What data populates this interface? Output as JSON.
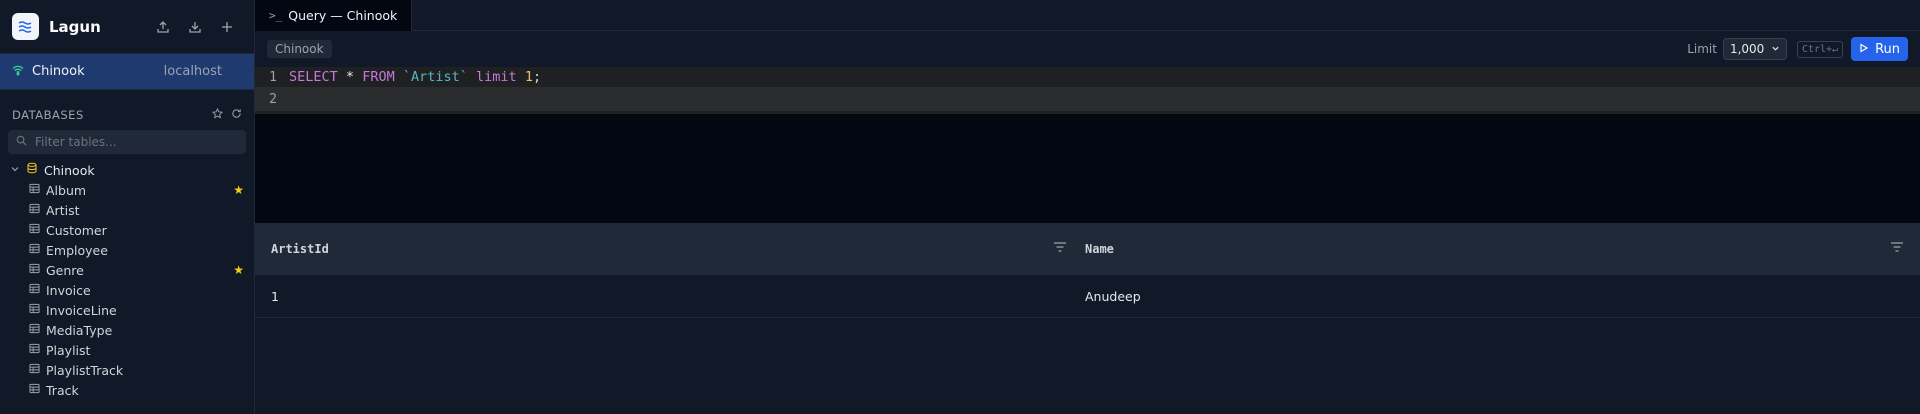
{
  "app": {
    "name": "Lagun"
  },
  "connection": {
    "name": "Chinook",
    "host": "localhost"
  },
  "sidebar": {
    "databases_title": "DATABASES",
    "filter_placeholder": "Filter tables...",
    "database": "Chinook",
    "tables": [
      {
        "label": "Album",
        "starred": true
      },
      {
        "label": "Artist",
        "starred": false
      },
      {
        "label": "Customer",
        "starred": false
      },
      {
        "label": "Employee",
        "starred": false
      },
      {
        "label": "Genre",
        "starred": true
      },
      {
        "label": "Invoice",
        "starred": false
      },
      {
        "label": "InvoiceLine",
        "starred": false
      },
      {
        "label": "MediaType",
        "starred": false
      },
      {
        "label": "Playlist",
        "starred": false
      },
      {
        "label": "PlaylistTrack",
        "starred": false
      },
      {
        "label": "Track",
        "starred": false
      }
    ]
  },
  "tab": {
    "icon": ">_",
    "label": "Query — Chinook"
  },
  "toolbar": {
    "db_chip": "Chinook",
    "limit_label": "Limit",
    "limit_value": "1,000",
    "shortcut": "Ctrl+↵",
    "run_label": "Run"
  },
  "editor": {
    "lines": [
      "1",
      "2"
    ],
    "query": {
      "kw1": "SELECT",
      "star": "*",
      "kw2": "FROM",
      "table": "`Artist`",
      "kw3": "limit",
      "num": "1",
      "end": ";"
    }
  },
  "results": {
    "columns": [
      "ArtistId",
      "Name"
    ],
    "rows": [
      [
        "1",
        "Anudeep"
      ]
    ]
  },
  "colors": {
    "accent": "#2563eb",
    "connection_bg": "#1e3a6e",
    "star": "#facc15",
    "keyword": "#c678dd",
    "identifier": "#56b6c2",
    "number": "#e5c07b"
  }
}
